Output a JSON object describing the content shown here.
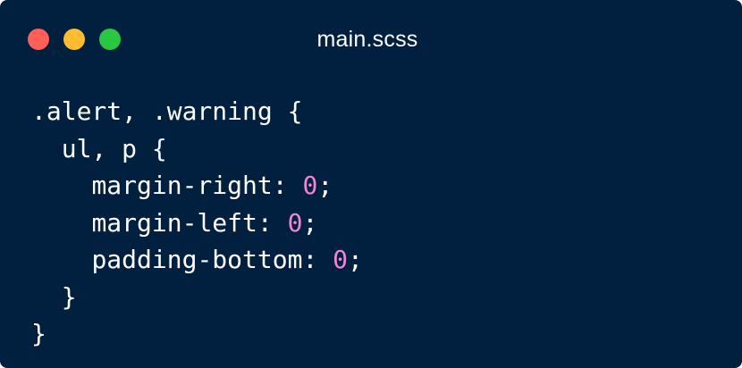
{
  "window": {
    "title": "main.scss",
    "background": "#011f3f",
    "traffic_lights": [
      {
        "name": "close",
        "color": "#fe5f57"
      },
      {
        "name": "minimize",
        "color": "#febc2e"
      },
      {
        "name": "maximize",
        "color": "#29c840"
      }
    ]
  },
  "code": {
    "number_color": "#ef86d6",
    "lines": [
      {
        "indent": "",
        "text": ".alert, .warning {",
        "value": "",
        "suffix": ""
      },
      {
        "indent": "  ",
        "text": "ul, p {",
        "value": "",
        "suffix": ""
      },
      {
        "indent": "    ",
        "text": "margin-right: ",
        "value": "0",
        "suffix": ";"
      },
      {
        "indent": "    ",
        "text": "margin-left: ",
        "value": "0",
        "suffix": ";"
      },
      {
        "indent": "    ",
        "text": "padding-bottom: ",
        "value": "0",
        "suffix": ";"
      },
      {
        "indent": "  ",
        "text": "}",
        "value": "",
        "suffix": ""
      },
      {
        "indent": "",
        "text": "}",
        "value": "",
        "suffix": ""
      }
    ]
  }
}
